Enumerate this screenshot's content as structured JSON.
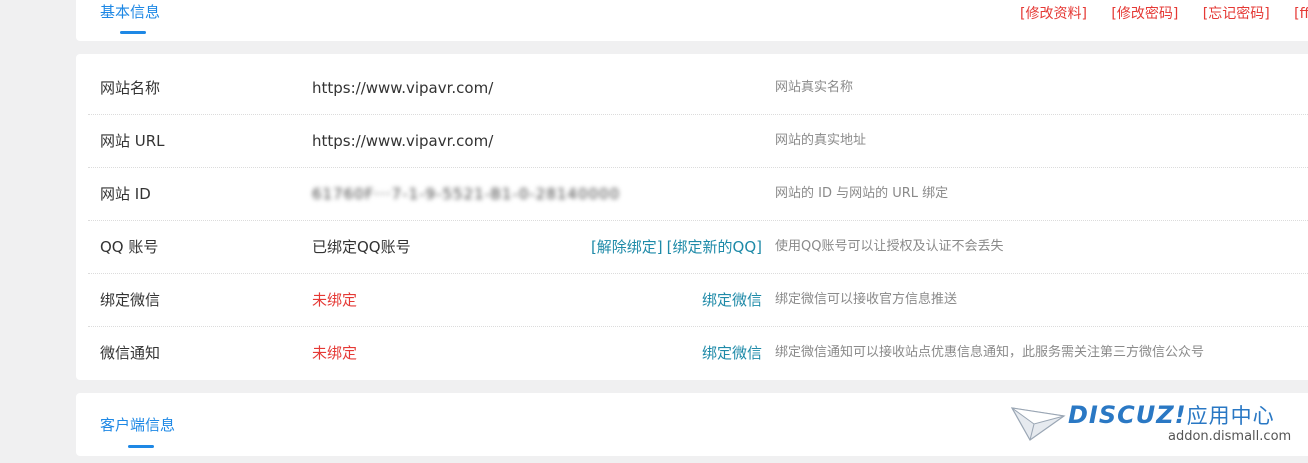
{
  "tabs": {
    "basic_info": "基本信息",
    "client_info": "客户端信息"
  },
  "top_links": [
    "[修改资料]",
    "[修改密码]",
    "[忘记密码]",
    "[ff"
  ],
  "rows": [
    {
      "label": "网站名称",
      "value": "https://www.vipavr.com/",
      "desc": "网站真实名称"
    },
    {
      "label": "网站 URL",
      "value": "https://www.vipavr.com/",
      "desc": "网站的真实地址"
    },
    {
      "label": "网站 ID",
      "value": "61760F···7-1-9-5521-B1-0-28140000",
      "desc": "网站的 ID 与网站的 URL 绑定"
    },
    {
      "label": "QQ 账号",
      "value": "已绑定QQ账号",
      "actions": [
        "[解除绑定]",
        "[绑定新的QQ]"
      ],
      "desc": "使用QQ账号可以让授权及认证不会丢失"
    },
    {
      "label": "绑定微信",
      "value": "未绑定",
      "actions": [
        "绑定微信"
      ],
      "desc": "绑定微信可以接收官方信息推送"
    },
    {
      "label": "微信通知",
      "value": "未绑定",
      "actions": [
        "绑定微信"
      ],
      "desc": "绑定微信通知可以接收站点优惠信息通知，此服务需关注第三方微信公众号"
    }
  ],
  "watermark": {
    "brand": "DISCUZ!",
    "brand_cn": "应用中心",
    "url": "addon.dismall.com"
  },
  "colors": {
    "accent": "#1e88e5",
    "link_red": "#e53935",
    "link_teal": "#1e8aa8"
  }
}
